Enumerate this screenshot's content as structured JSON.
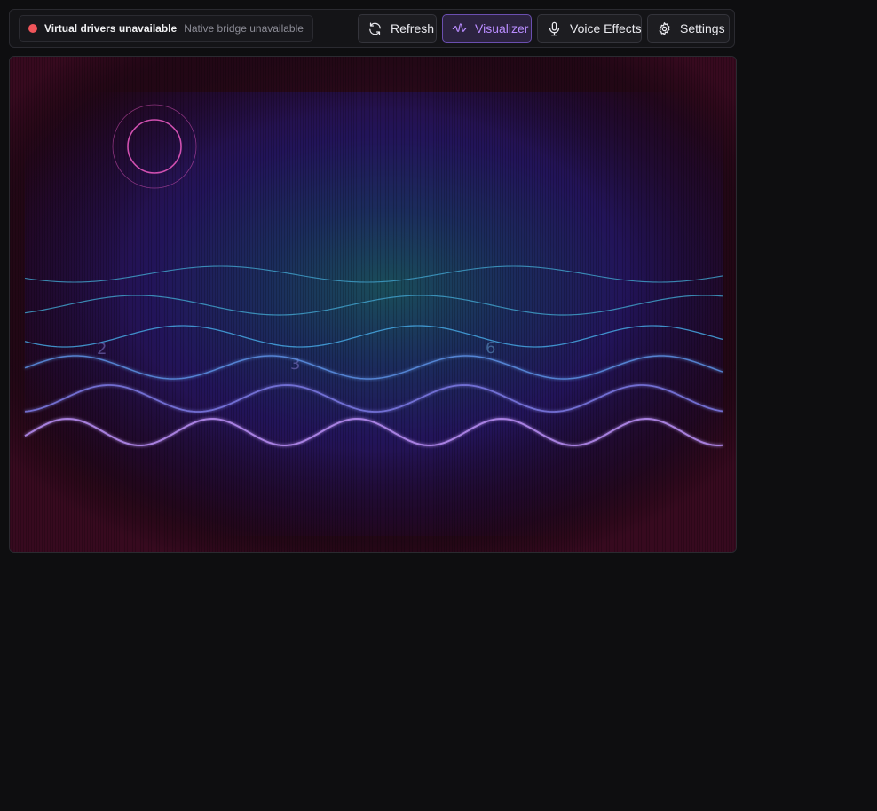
{
  "status": {
    "title": "Virtual drivers unavailable",
    "subtitle": "Native bridge unavailable",
    "dot_color": "#f0555a"
  },
  "toolbar": {
    "buttons": [
      {
        "label": "Refresh",
        "icon": "refresh-icon",
        "active": false
      },
      {
        "label": "Visualizer",
        "icon": "waveform-icon",
        "active": true
      },
      {
        "label": "Voice Effects",
        "icon": "microphone-icon",
        "active": false
      },
      {
        "label": "Settings",
        "icon": "gear-icon",
        "active": false
      }
    ],
    "accent_color": "#b98cff"
  },
  "visualizer": {
    "wave_colors": [
      "#3f9fc8",
      "#3f9fc8",
      "#45a6e0",
      "#5a8ee0",
      "#7a78e0",
      "#b58cf0"
    ],
    "circle_color": "#d050b0",
    "scribbles": [
      "2",
      "3",
      "6"
    ]
  }
}
